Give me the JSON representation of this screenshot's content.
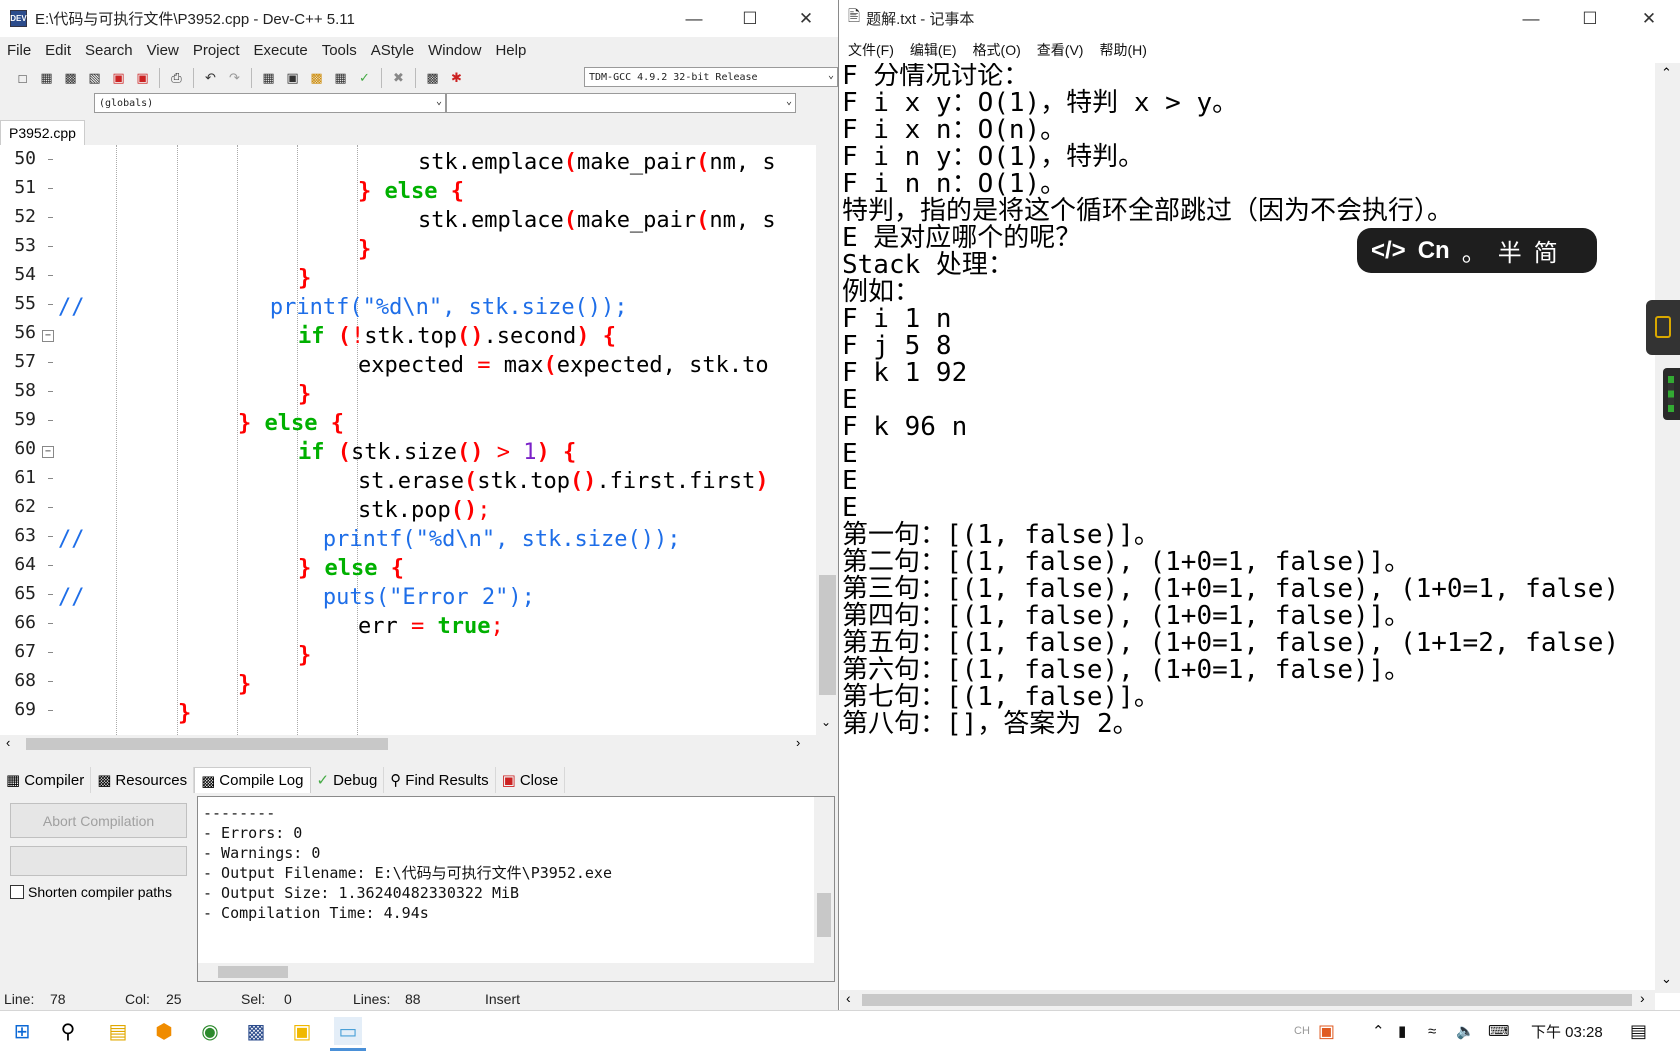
{
  "devcpp": {
    "title": "E:\\代码与可执行文件\\P3952.cpp - Dev-C++ 5.11",
    "menu": [
      "File",
      "Edit",
      "Search",
      "View",
      "Project",
      "Execute",
      "Tools",
      "AStyle",
      "Window",
      "Help"
    ],
    "compiler_select": "TDM-GCC 4.9.2 32-bit Release",
    "scope_select": "(globals)",
    "file_tab": "P3952.cpp",
    "line_numbers": [
      "50",
      "51",
      "52",
      "53",
      "54",
      "55",
      "56",
      "57",
      "58",
      "59",
      "60",
      "61",
      "62",
      "63",
      "64",
      "65",
      "66",
      "67",
      "68",
      "69"
    ],
    "bottom_tabs": [
      "Compiler",
      "Resources",
      "Compile Log",
      "Debug",
      "Find Results",
      "Close"
    ],
    "abort_button": "Abort Compilation",
    "shorten_paths_label": "Shorten compiler paths",
    "log_lines": [
      "--------",
      "- Errors: 0",
      "- Warnings: 0",
      "- Output Filename: E:\\代码与可执行文件\\P3952.exe",
      "- Output Size: 1.36240482330322 MiB",
      "- Compilation Time: 4.94s"
    ],
    "status": {
      "line_label": "Line:",
      "line_value": "78",
      "col_label": "Col:",
      "col_value": "25",
      "sel_label": "Sel:",
      "sel_value": "0",
      "lines_label": "Lines:",
      "lines_value": "88",
      "mode": "Insert"
    }
  },
  "notepad": {
    "title": "题解.txt - 记事本",
    "menu": [
      "文件(F)",
      "编辑(E)",
      "格式(O)",
      "查看(V)",
      "帮助(H)"
    ],
    "lines": [
      "F 分情况讨论：",
      "F i x y：O(1)，特判 x > y。",
      "F i x n：O(n)。",
      "F i n y：O(1)，特判。",
      "F i n n：O(1)。",
      "特判，指的是将这个循环全部跳过（因为不会执行）。",
      "E 是对应哪个的呢？",
      "Stack 处理：",
      "例如：",
      "F i 1 n",
      "F j 5 8",
      "F k 1 92",
      "E",
      "F k 96 n",
      "E",
      "E",
      "E",
      "第一句：[(1, false)]。",
      "第二句：[(1, false), (1+0=1, false)]。",
      "第三句：[(1, false), (1+0=1, false), (1+0=1, false)",
      "第四句：[(1, false), (1+0=1, false)]。",
      "第五句：[(1, false), (1+0=1, false), (1+1=2, false)",
      "第六句：[(1, false), (1+0=1, false)]。",
      "第七句：[(1, false)]。",
      "第八句：[]，答案为 2。"
    ],
    "ime": {
      "code_icon": "</>",
      "lang": "Cn",
      "punct": "。",
      "width": "半",
      "script": "简"
    }
  },
  "taskbar": {
    "ime_tray": "CH",
    "time": "下午 03:28"
  },
  "colors": {
    "keyword": "#00b000",
    "brace": "#ff0000",
    "comment": "#1e6ee8",
    "number": "#7b22c8"
  }
}
